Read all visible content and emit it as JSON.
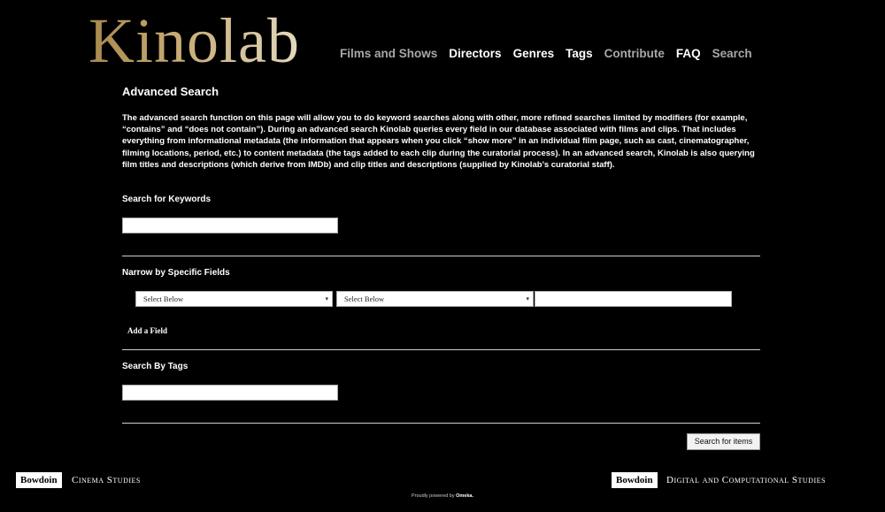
{
  "header": {
    "logo": "Kinolab",
    "nav": [
      {
        "label": "Films and Shows",
        "style": "dim"
      },
      {
        "label": "Directors",
        "style": "bright"
      },
      {
        "label": "Genres",
        "style": "bright"
      },
      {
        "label": "Tags",
        "style": "bright"
      },
      {
        "label": "Contribute",
        "style": "dim"
      },
      {
        "label": "FAQ",
        "style": "bright"
      },
      {
        "label": "Search",
        "style": "dim"
      }
    ]
  },
  "main": {
    "title": "Advanced Search",
    "intro": "The advanced search function on this page will allow you to do keyword searches along with other, more refined searches limited by modifiers (for example, “contains” and “does not contain”). During an advanced search Kinolab queries every field in our database associated with films and clips. That includes everything from informational metadata (the information that appears when you click “show more” in an individual film page, such as cast, cinematographer, filming locations, period, etc.) to content metadata (the tags added to each clip during the curatorial process). In an advanced search, Kinolab is also querying film titles and descriptions (which derive from IMDb) and clip titles and descriptions (supplied by Kinolab’s curatorial staff).",
    "keywords": {
      "label": "Search for Keywords",
      "value": ""
    },
    "narrow": {
      "label": "Narrow by Specific Fields",
      "field_select": "Select Below",
      "operator_select": "Select Below",
      "value": "",
      "add_field": "Add a Field"
    },
    "tags": {
      "label": "Search By Tags",
      "value": ""
    },
    "search_button": "Search for items"
  },
  "footer": {
    "left_badge": "Bowdoin",
    "left_text": "Cinema Studies",
    "right_badge": "Bowdoin",
    "right_text": "Digital and Computational Studies",
    "powered_prefix": "Proudly powered by",
    "powered_brand": "Omeka."
  },
  "colors": {
    "background": "#000000",
    "logo_gold": "#b99a5e",
    "nav_dim": "#a8a8a8"
  }
}
